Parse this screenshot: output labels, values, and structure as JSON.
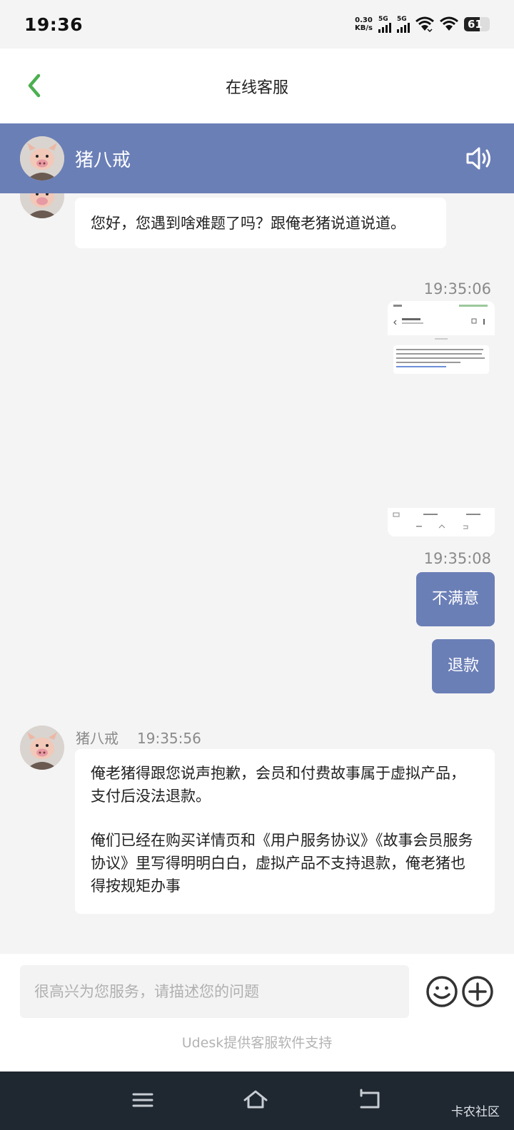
{
  "status_bar": {
    "time": "19:36",
    "net_speed_value": "0.30",
    "net_speed_unit": "KB/s",
    "sim1_label": "5G",
    "sim2_label": "5G",
    "battery_level": "61",
    "icons": [
      "signal-icon",
      "signal-icon",
      "wifi-icon",
      "wifi-icon",
      "battery-icon"
    ]
  },
  "header": {
    "title": "在线客服",
    "back_icon": "back-arrow-icon",
    "accent_color": "#4caf50"
  },
  "agent": {
    "name": "猪八戒",
    "sound_icon": "speaker-icon",
    "bar_color": "#6b7fb7"
  },
  "messages": {
    "greeting": "您好，您遇到啥难题了吗？跟俺老猪说道说道。",
    "time1": "19:35:06",
    "time2": "19:35:08",
    "user_msg1": "不满意",
    "user_msg2": "退款",
    "reply_sender": "猪八戒",
    "reply_time": "19:35:56",
    "reply_p1": "俺老猪得跟您说声抱歉，会员和付费故事属于虚拟产品，支付后没法退款。",
    "reply_p2": "俺们已经在购买详情页和《用户服务协议》《故事会员服务协议》里写得明明白白，虚拟产品不支持退款，俺老猪也得按规矩办事"
  },
  "input": {
    "placeholder": "很高兴为您服务，请描述您的问题",
    "emoji_icon": "emoji-icon",
    "plus_icon": "plus-icon",
    "powered_by": "Udesk提供客服软件支持"
  },
  "system_nav": {
    "menu_icon": "menu-icon",
    "home_icon": "home-icon",
    "back_icon": "back-icon",
    "watermark": "卡农社区"
  }
}
